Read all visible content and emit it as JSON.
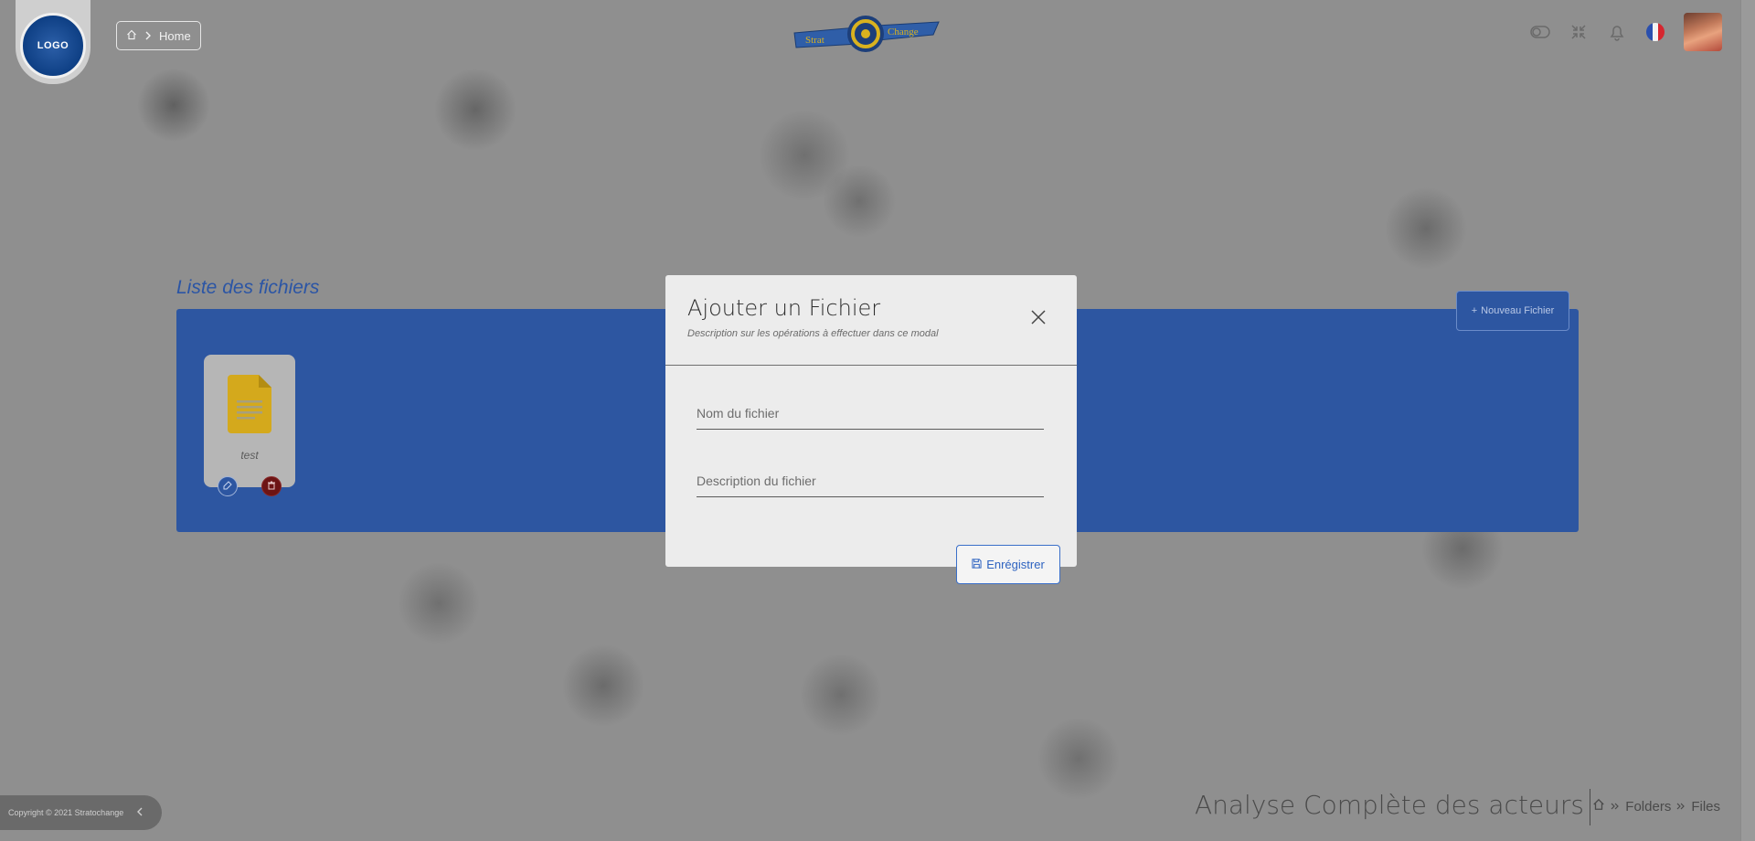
{
  "header": {
    "logo_text": "LOGO",
    "breadcrumb_home": "Home",
    "brand_left": "Strat",
    "brand_right": "Change"
  },
  "icons": {
    "toggle": "toggle-icon",
    "compress": "compress-icon",
    "bell": "bell-icon",
    "flag": "france-flag-icon",
    "avatar": "user-avatar"
  },
  "main": {
    "section_title": "Liste des fichiers",
    "new_file_label": "Nouveau Fichier",
    "new_file_prefix": "+",
    "files": [
      {
        "name": "test"
      }
    ]
  },
  "modal": {
    "title": "Ajouter un Fichier",
    "subtitle": "Description sur les opérations à effectuer dans ce modal",
    "name_placeholder": "Nom du fichier",
    "description_placeholder": "Description du fichier",
    "save_label": "Enrégistrer"
  },
  "footer": {
    "copyright": "Copyright © 2021 Stratochange",
    "page_title": "Analyse Complète des acteurs",
    "breadcrumb": [
      "Folders",
      "Files"
    ]
  },
  "colors": {
    "primary": "#2d56a1",
    "accent": "#2e63c0",
    "danger": "#6d1414",
    "file_icon": "#d4a91c"
  }
}
